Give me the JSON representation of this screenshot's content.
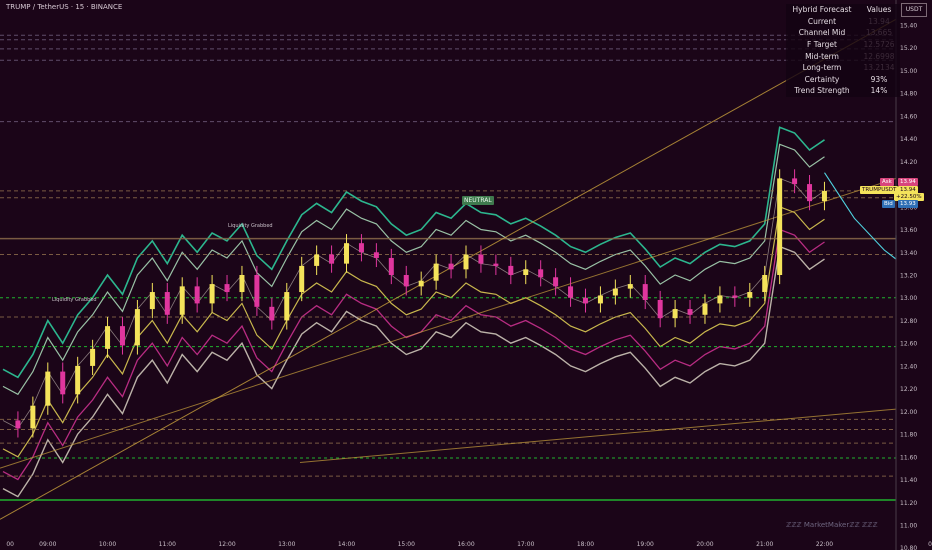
{
  "header": {
    "title": "TRUMP / TetherUS · 15 · BINANCE",
    "currency_button": "USDT"
  },
  "forecast_table": {
    "header_label": "Hybrid Forecast",
    "header_values": "Values",
    "rows": [
      {
        "label": "Current",
        "value": "13.94",
        "dim": true
      },
      {
        "label": "Channel Mid",
        "value": "13.665",
        "dim": true
      },
      {
        "label": "F Target",
        "value": "12.5726",
        "dim": true
      },
      {
        "label": "Mid-term",
        "value": "12.6998",
        "dim": true
      },
      {
        "label": "Long-term",
        "value": "13.2134",
        "dim": true
      },
      {
        "label": "Certainty",
        "value": "93%",
        "dim": false
      },
      {
        "label": "Trend Strength",
        "value": "14%",
        "dim": false
      }
    ]
  },
  "price_tags": {
    "ask_label": "Ask",
    "ask_value": "13.94",
    "symbol_label": "TRUMPUSDT",
    "symbol_value": "13.94",
    "change_value": "+22.50%",
    "bid_label": "Bid",
    "bid_value": "13.93"
  },
  "annotations": {
    "neutral_label": "NEUTRAL",
    "liquidity_grabbed": "Liquidity Grabbed"
  },
  "watermark": "ℤℤℤ MarketMakerℤℤ ℤℤℤ",
  "colors": {
    "background": "#1b0518",
    "bull_candle": "#f4e35b",
    "bear_candle": "#e0369e",
    "level_green": "#22d033",
    "trend_gold": "#c9a13c",
    "forecast_cyan": "#4fd3e0",
    "band_white": "#f2ecd8",
    "band_teal": "#2fd6a3"
  },
  "chart_data": {
    "type": "line",
    "title": "TRUMP / TetherUS · 15 · BINANCE",
    "y_axis_ticks": [
      15.4,
      15.2,
      15.0,
      14.8,
      14.6,
      14.4,
      14.2,
      14.0,
      13.8,
      13.6,
      13.4,
      13.2,
      13.0,
      12.8,
      12.6,
      12.4,
      12.2,
      12.0,
      11.8,
      11.6,
      11.4,
      11.2,
      11.0,
      10.8
    ],
    "ylim": [
      10.78,
      15.62
    ],
    "x_axis_ticks": [
      "00",
      "09:00",
      "10:00",
      "11:00",
      "12:00",
      "13:00",
      "14:00",
      "15:00",
      "16:00",
      "17:00",
      "18:00",
      "19:00",
      "20:00",
      "21:00",
      "22:00",
      "00"
    ],
    "x_axis_tick_positions_hours": [
      8.37,
      9,
      10,
      11,
      12,
      13,
      14,
      15,
      16,
      17,
      18,
      19,
      20,
      21,
      22,
      23.8
    ],
    "xlim_hours": [
      8.2,
      23.8
    ],
    "candles_end_hour": 22.5,
    "series": [
      {
        "name": "",
        "kind": "close",
        "x": [
          8.25,
          8.5,
          8.75,
          9,
          9.25,
          9.5,
          9.75,
          10,
          10.25,
          10.5,
          10.75,
          11,
          11.25,
          11.5,
          11.75,
          12,
          12.25,
          12.5,
          12.75,
          13,
          13.25,
          13.5,
          13.75,
          14,
          14.25,
          14.5,
          14.75,
          15,
          15.25,
          15.5,
          15.75,
          16,
          16.25,
          16.5,
          16.75,
          17,
          17.25,
          17.5,
          17.75,
          18,
          18.25,
          18.5,
          18.75,
          19,
          19.25,
          19.5,
          19.75,
          20,
          20.25,
          20.5,
          20.75,
          21,
          21.25,
          21.5,
          21.75,
          22
        ],
        "y": [
          11.92,
          11.85,
          12.05,
          12.35,
          12.15,
          12.4,
          12.55,
          12.75,
          12.58,
          12.9,
          13.05,
          12.85,
          13.1,
          12.95,
          13.12,
          13.05,
          13.2,
          12.92,
          12.8,
          13.05,
          13.28,
          13.38,
          13.3,
          13.48,
          13.4,
          13.35,
          13.2,
          13.1,
          13.15,
          13.3,
          13.25,
          13.38,
          13.3,
          13.28,
          13.2,
          13.25,
          13.18,
          13.1,
          13.0,
          12.95,
          13.02,
          13.08,
          13.12,
          12.98,
          12.82,
          12.9,
          12.85,
          12.95,
          13.02,
          13.0,
          13.05,
          13.2,
          14.05,
          14.0,
          13.85,
          13.94
        ]
      },
      {
        "name": "",
        "kind": "forecast",
        "x": [
          22.0,
          22.5,
          23.0,
          23.5,
          24.0,
          24.5,
          25.0,
          25.5,
          26.0
        ],
        "y": [
          14.1,
          13.7,
          13.42,
          13.34,
          13.42,
          13.52,
          13.55,
          13.48,
          13.34
        ]
      }
    ],
    "horizontal_levels": [
      15.31,
      15.27,
      15.19,
      15.09,
      14.55,
      13.94,
      13.88,
      13.52,
      13.38,
      13.0,
      12.83,
      12.57,
      11.93,
      11.84,
      11.72,
      11.59,
      11.43,
      11.22
    ]
  }
}
